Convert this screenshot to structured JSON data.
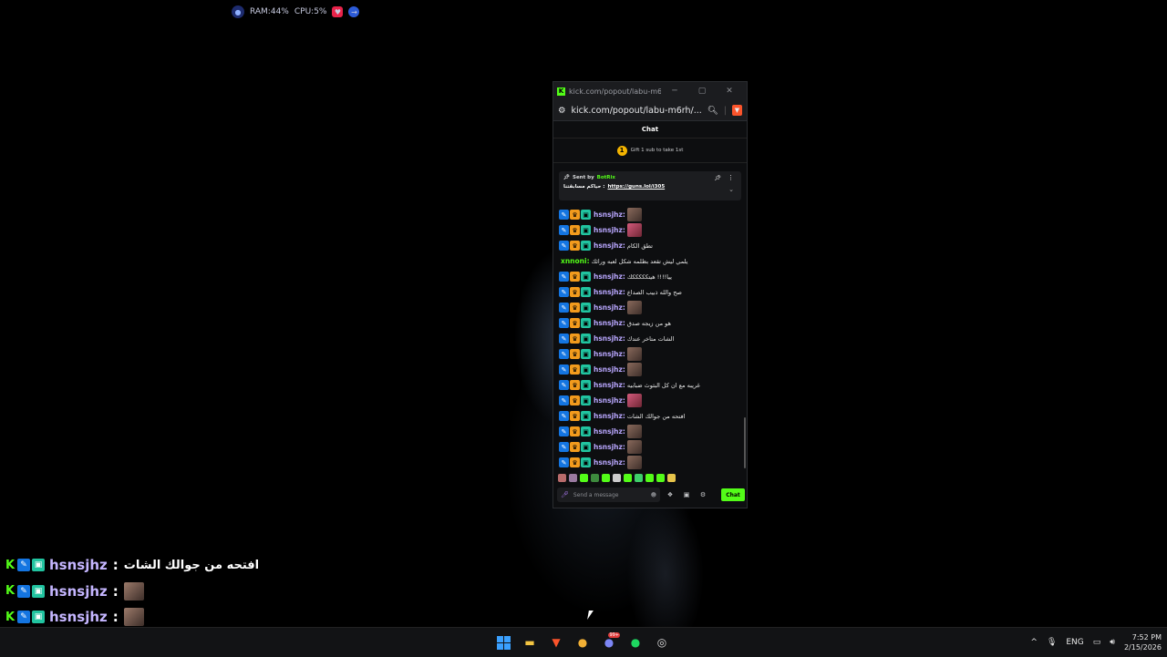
{
  "sysmon": {
    "ram": "RAM:44%",
    "cpu": "CPU:5%"
  },
  "window": {
    "title": "kick.com/popout/labu-m6r...",
    "url": "kick.com/popout/labu-m6rh/...",
    "chat_header": "Chat",
    "gift_text": "Gift 1 sub to take 1st",
    "gift_rank": "1",
    "pinned": {
      "sent_by": "Sent by",
      "bot": "BotRix",
      "text": "حياكم مسابقتنا :",
      "link": "https://guns.lol/i305"
    },
    "messages": [
      {
        "user": "hsnsjhz:",
        "text": "",
        "emote": true,
        "pink": false
      },
      {
        "user": "hsnsjhz:",
        "text": "",
        "emote": true,
        "pink": true
      },
      {
        "user": "hsnsjhz:",
        "text": "تطق الكام",
        "emote": false,
        "pink": false
      },
      {
        "user": "xnnoni:",
        "text": "يلمي ليش تقعد بظلمه شكل لعبه ورائك",
        "emote": false,
        "green": true,
        "nobadge": true
      },
      {
        "user": "hsnsjhz:",
        "text": "ييا!!!! هيتكككككك",
        "emote": false
      },
      {
        "user": "hsnsjhz:",
        "text": "صح والله ذبيب الصداع",
        "emote": false
      },
      {
        "user": "hsnsjhz:",
        "text": "",
        "emote": true,
        "pink": false
      },
      {
        "user": "hsnsjhz:",
        "text": "هو من زيجه صدق",
        "emote": false
      },
      {
        "user": "hsnsjhz:",
        "text": "الشات متاخر عندك",
        "emote": false
      },
      {
        "user": "hsnsjhz:",
        "text": "",
        "emote": true,
        "pink": false
      },
      {
        "user": "hsnsjhz:",
        "text": "",
        "emote": true,
        "pink": false
      },
      {
        "user": "hsnsjhz:",
        "text": "غريبه مع ان كل البثوث ضبابيه",
        "emote": false
      },
      {
        "user": "hsnsjhz:",
        "text": "",
        "emote": true,
        "pink": true
      },
      {
        "user": "hsnsjhz:",
        "text": "افتحه من جوالك الشات",
        "emote": false
      },
      {
        "user": "hsnsjhz:",
        "text": "",
        "emote": true,
        "pink": false
      },
      {
        "user": "hsnsjhz:",
        "text": "",
        "emote": true,
        "pink": false
      },
      {
        "user": "hsnsjhz:",
        "text": "",
        "emote": true,
        "pink": false
      }
    ],
    "input_placeholder": "Send a message",
    "chat_button": "Chat",
    "emote_colors": [
      "#b86b6b",
      "#9a7aa0",
      "#53fc18",
      "#3d8a3d",
      "#53fc18",
      "#cccccc",
      "#53fc18",
      "#3ecf6a",
      "#53fc18",
      "#53fc18",
      "#e6c34a"
    ]
  },
  "overlay": [
    {
      "user": "hsnsjhz",
      "text": "افتحه من جوالك الشات",
      "emote": false
    },
    {
      "user": "hsnsjhz",
      "text": "",
      "emote": true
    },
    {
      "user": "hsnsjhz",
      "text": "",
      "emote": true
    },
    {
      "user": "hsnsjhz",
      "text": "",
      "emote": true
    }
  ],
  "taskbar": {
    "lang": "ENG",
    "time": "7:52 PM",
    "date": "2/15/2026",
    "discord_badge": "99+"
  },
  "colors": {
    "kick_green": "#53fc18",
    "accent_blue": "#3aa0ff"
  }
}
